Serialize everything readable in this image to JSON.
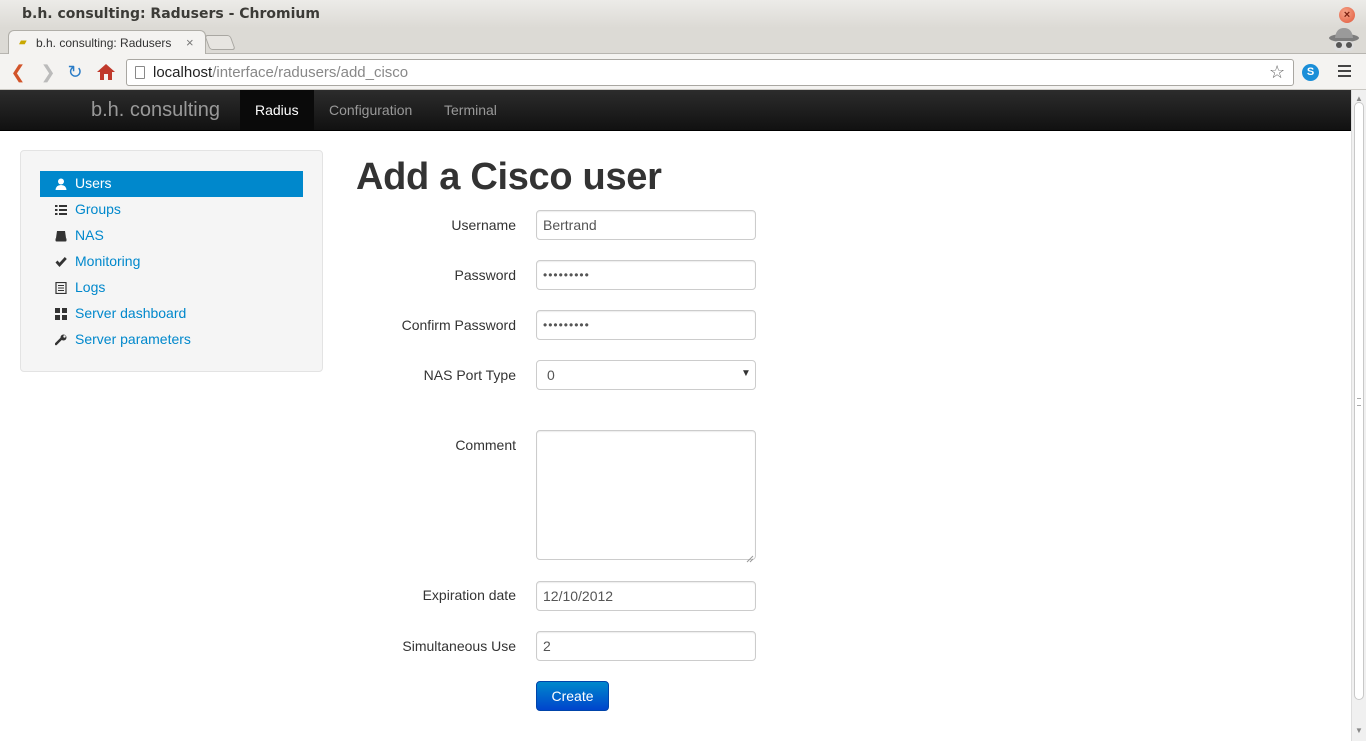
{
  "window": {
    "title": "b.h. consulting: Radusers - Chromium",
    "close_glyph": "×"
  },
  "tab": {
    "label": "b.h. consulting: Radusers",
    "close_glyph": "×"
  },
  "address": {
    "host": "localhost",
    "path": "/interface/radusers/add_cisco"
  },
  "navbar": {
    "brand": "b.h. consulting",
    "items": [
      {
        "label": "Radius",
        "active": true
      },
      {
        "label": "Configuration",
        "active": false
      },
      {
        "label": "Terminal",
        "active": false
      }
    ]
  },
  "sidebar": {
    "items": [
      {
        "label": "Users",
        "icon": "user-icon",
        "active": true
      },
      {
        "label": "Groups",
        "icon": "list-icon",
        "active": false
      },
      {
        "label": "NAS",
        "icon": "hdd-icon",
        "active": false
      },
      {
        "label": "Monitoring",
        "icon": "check-icon",
        "active": false
      },
      {
        "label": "Logs",
        "icon": "list-alt-icon",
        "active": false
      },
      {
        "label": "Server dashboard",
        "icon": "th-large-icon",
        "active": false
      },
      {
        "label": "Server parameters",
        "icon": "wrench-icon",
        "active": false
      }
    ]
  },
  "form": {
    "title": "Add a Cisco user",
    "username": {
      "label": "Username",
      "value": "Bertrand"
    },
    "password": {
      "label": "Password",
      "value": "•••••••••"
    },
    "confirm_password": {
      "label": "Confirm Password",
      "value": "•••••••••"
    },
    "nas_port_type": {
      "label": "NAS Port Type",
      "value": "0"
    },
    "comment": {
      "label": "Comment",
      "value": ""
    },
    "expiration_date": {
      "label": "Expiration date",
      "value": "12/10/2012"
    },
    "simultaneous_use": {
      "label": "Simultaneous Use",
      "value": "2"
    },
    "submit_label": "Create"
  },
  "colors": {
    "accent": "#0088cc",
    "navbar": "#1b1b1b",
    "sidebar_bg": "#f5f5f5"
  }
}
